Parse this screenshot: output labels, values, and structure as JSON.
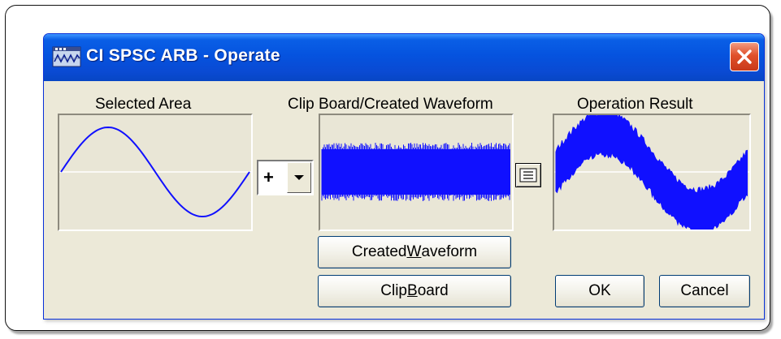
{
  "window": {
    "title": "CI SPSC ARB - Operate",
    "close_icon": "close-x-icon",
    "app_icon": "waveform-app-icon"
  },
  "panels": {
    "selected_area": {
      "label": "Selected Area"
    },
    "clipboard": {
      "label": "Clip Board/Created Waveform"
    },
    "result": {
      "label": "Operation Result"
    }
  },
  "operator": {
    "value": "+",
    "arrow_icon": "chevron-down-icon"
  },
  "list_button": {
    "icon": "list-icon"
  },
  "buttons": {
    "created_waveform": {
      "pre": "Created ",
      "mnemonic": "W",
      "post": "aveform"
    },
    "clip_board": {
      "pre": "Clip ",
      "mnemonic": "B",
      "post": "oard"
    },
    "ok": "OK",
    "cancel": "Cancel"
  },
  "colors": {
    "titlebar": "#0553df",
    "dialog_bg": "#ece9d8",
    "waveform": "#1010ff",
    "close_button": "#e0502a"
  }
}
